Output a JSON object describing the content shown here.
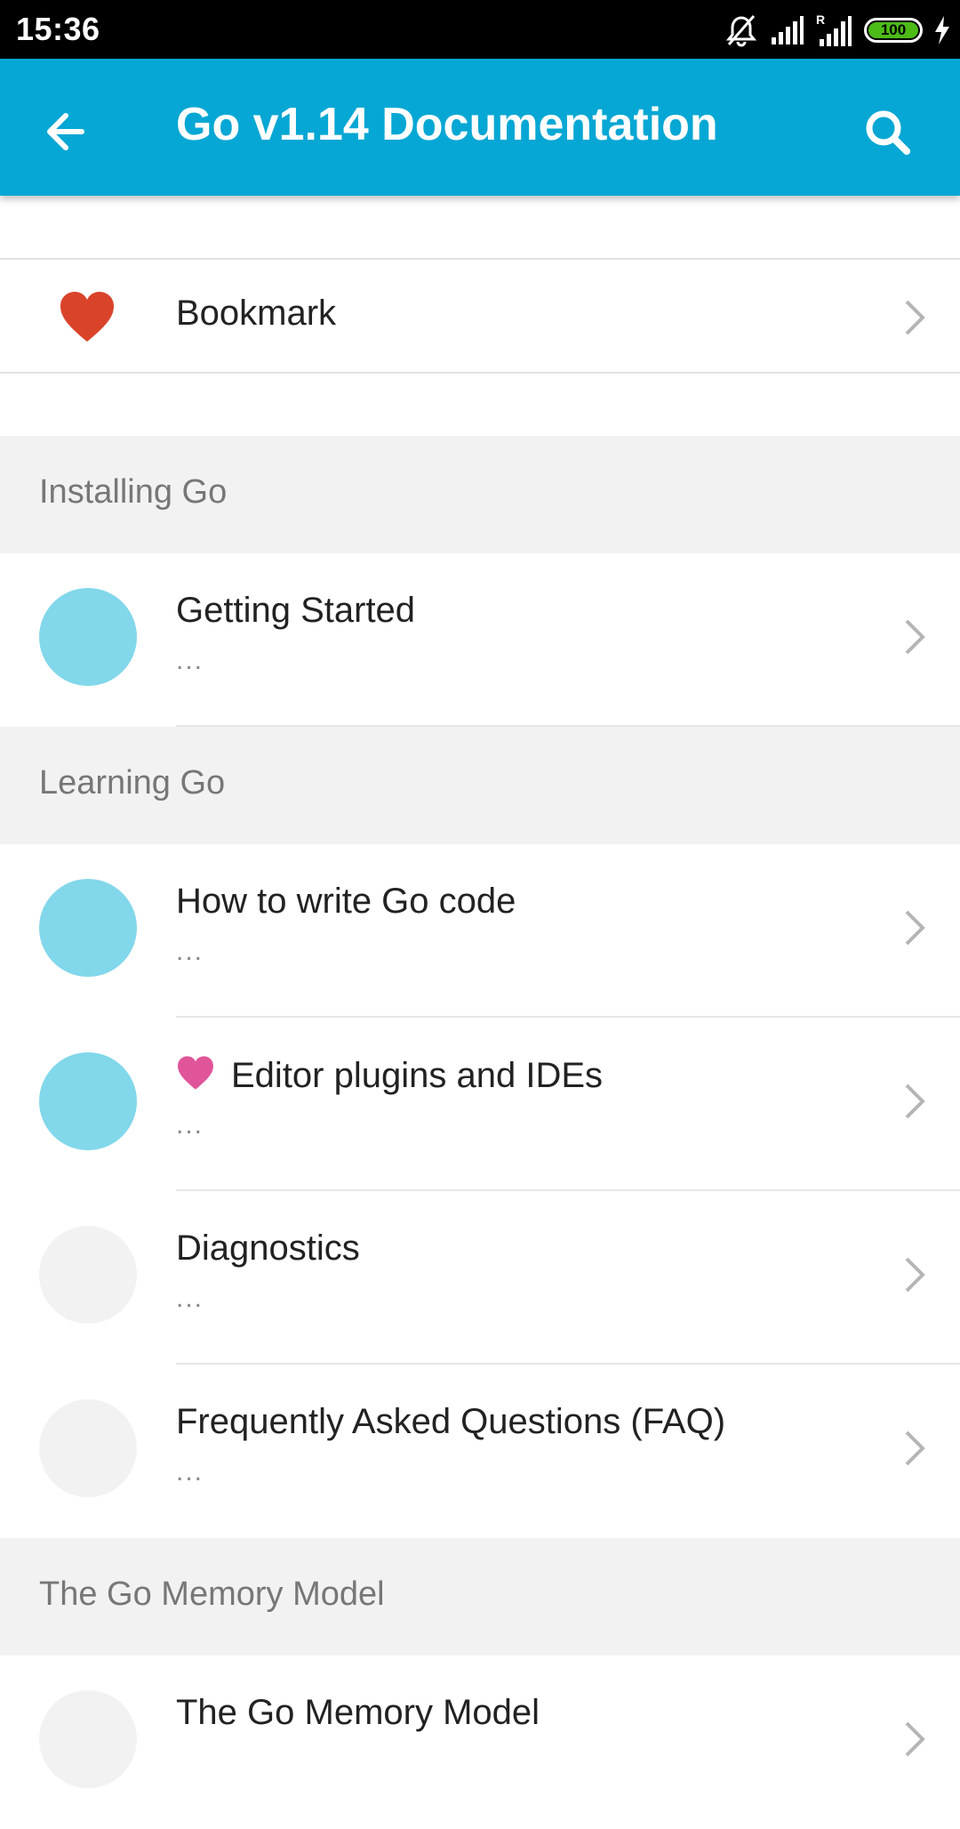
{
  "status_bar": {
    "time": "15:36",
    "battery": "100"
  },
  "app_bar": {
    "title": "Go v1.14 Documentation"
  },
  "bookmark": {
    "label": "Bookmark"
  },
  "sections": [
    {
      "label": "Installing Go"
    },
    {
      "label": "Learning Go"
    },
    {
      "label": "The Go Memory Model"
    }
  ],
  "items": [
    {
      "title": "Getting Started",
      "sub": "...",
      "avatar_color": "#82d7eb",
      "favorite": false
    },
    {
      "title": "How to write Go code",
      "sub": "...",
      "avatar_color": "#82d7eb",
      "favorite": false
    },
    {
      "title": "Editor plugins and IDEs",
      "sub": "...",
      "avatar_color": "#82d7eb",
      "favorite": true
    },
    {
      "title": "Diagnostics",
      "sub": "...",
      "avatar_color": "#f2f2f2",
      "favorite": false
    },
    {
      "title": "Frequently Asked Questions (FAQ)",
      "sub": "...",
      "avatar_color": "#f2f2f2",
      "favorite": false
    },
    {
      "title": "The Go Memory Model",
      "sub": "",
      "avatar_color": "#f2f2f2",
      "favorite": false
    }
  ],
  "colors": {
    "app_bar": "#06a7d4",
    "heart_red": "#d9432a",
    "heart_pink": "#e0559a",
    "avatar_blue": "#82d7eb",
    "avatar_grey": "#f2f2f2"
  },
  "icons": {
    "back": "arrow-left-icon",
    "search": "search-icon",
    "bookmark": "heart-icon",
    "chevron": "chevron-right-icon"
  }
}
